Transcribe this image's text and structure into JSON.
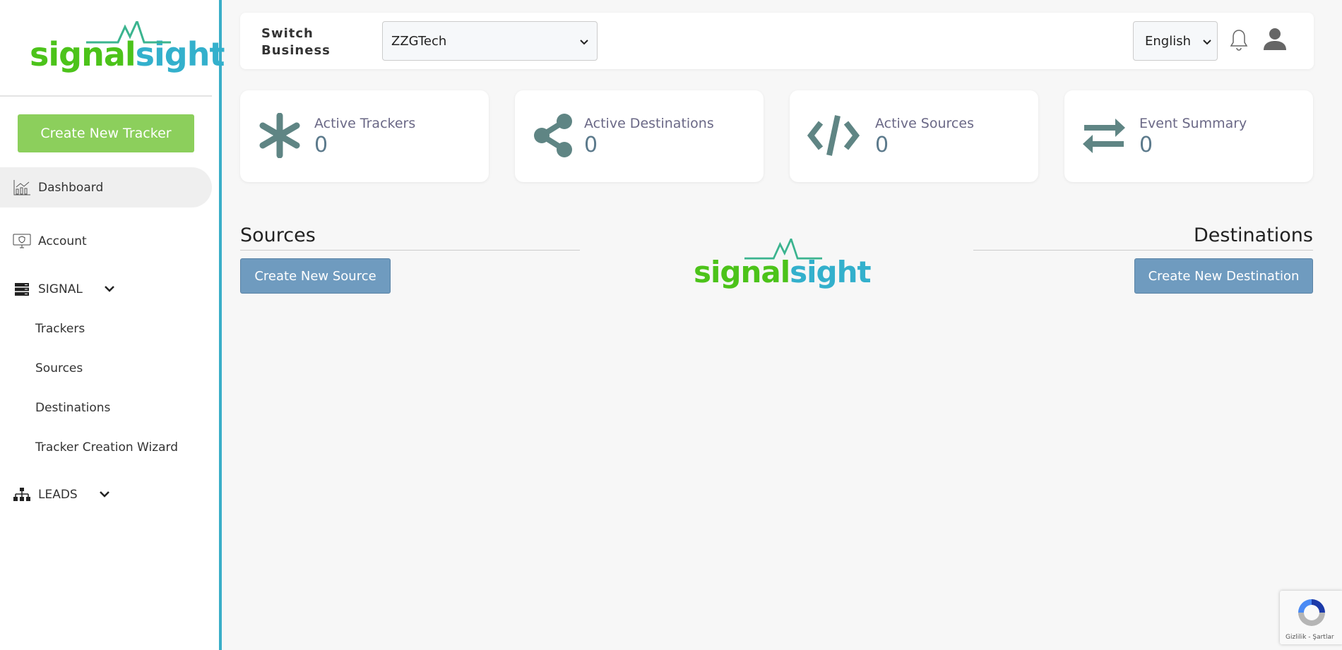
{
  "brand": {
    "logo_part1": "signal",
    "logo_part2": "sight",
    "green": "#4cc31a",
    "blue": "#33b0cc",
    "sidebar_border": "#3aaec8"
  },
  "sidebar": {
    "create_tracker": "Create New Tracker",
    "items": [
      {
        "label": "Dashboard",
        "icon": "chart-icon",
        "active": true
      },
      {
        "label": "Account",
        "icon": "monitor-shield-icon"
      },
      {
        "label": "SIGNAL",
        "icon": "server-icon",
        "expanded": true
      },
      {
        "label": "LEADS",
        "icon": "sitemap-icon"
      }
    ],
    "signal_sub": [
      "Trackers",
      "Sources",
      "Destinations",
      "Tracker Creation Wizard"
    ]
  },
  "header": {
    "switch_label": "Switch Business",
    "business": "ZZGTech",
    "language": "English"
  },
  "stats": [
    {
      "label": "Active Trackers",
      "value": "0",
      "icon": "asterisk-icon"
    },
    {
      "label": "Active Destinations",
      "value": "0",
      "icon": "share-icon"
    },
    {
      "label": "Active Sources",
      "value": "0",
      "icon": "code-icon"
    },
    {
      "label": "Event Summary",
      "value": "0",
      "icon": "exchange-icon"
    }
  ],
  "sources": {
    "title": "Sources",
    "button": "Create New Source"
  },
  "destinations": {
    "title": "Destinations",
    "button": "Create New Destination"
  },
  "recaptcha": {
    "text": "Gizlilik - Şartlar"
  }
}
